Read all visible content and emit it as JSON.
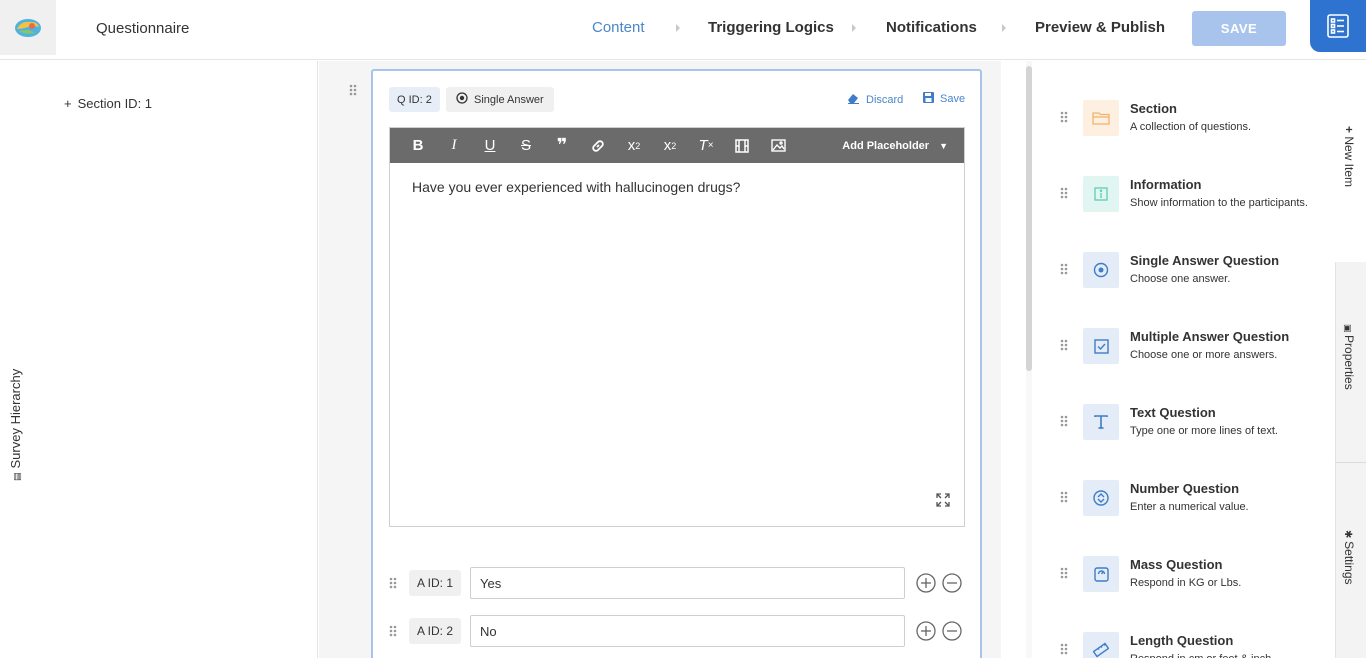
{
  "header": {
    "app_title": "Questionnaire",
    "nav": [
      {
        "label": "Content",
        "active": true
      },
      {
        "label": "Triggering Logics",
        "active": false
      },
      {
        "label": "Notifications",
        "active": false
      },
      {
        "label": "Preview & Publish",
        "active": false
      }
    ],
    "save_label": "SAVE",
    "logo_icon": "brain-logo-icon",
    "topright_icon": "checklist-icon"
  },
  "left_panel": {
    "vertical_label": "Survey Hierarchy",
    "tree": [
      {
        "expand": "+",
        "label": "Section ID: 1"
      }
    ]
  },
  "question": {
    "qid_label": "Q ID: 2",
    "type_label": "Single Answer",
    "discard_label": "Discard",
    "save_label": "Save",
    "add_placeholder_label": "Add Placeholder",
    "text": "Have you ever experienced with hallucinogen drugs?",
    "answers": [
      {
        "id_label": "A ID: 1",
        "value": "Yes"
      },
      {
        "id_label": "A ID: 2",
        "value": "No"
      }
    ]
  },
  "right_panel": {
    "items": [
      {
        "title": "Section",
        "desc": "A collection of questions.",
        "icon": "folder-icon",
        "icon_bg": "#fdf0e1",
        "icon_color": "#f2b36b"
      },
      {
        "title": "Information",
        "desc": "Show information to the participants.",
        "icon": "info-icon",
        "icon_bg": "#e2f6f1",
        "icon_color": "#5ccfb3"
      },
      {
        "title": "Single Answer Question",
        "desc": "Choose one answer.",
        "icon": "radio-icon",
        "icon_bg": "#e4ecf7",
        "icon_color": "#3f7cc9"
      },
      {
        "title": "Multiple Answer Question",
        "desc": "Choose one or more answers.",
        "icon": "checkbox-icon",
        "icon_bg": "#e4ecf7",
        "icon_color": "#3f7cc9"
      },
      {
        "title": "Text Question",
        "desc": "Type one or more lines of text.",
        "icon": "text-icon",
        "icon_bg": "#e4ecf7",
        "icon_color": "#3f7cc9"
      },
      {
        "title": "Number Question",
        "desc": "Enter a numerical value.",
        "icon": "number-icon",
        "icon_bg": "#e4ecf7",
        "icon_color": "#3f7cc9"
      },
      {
        "title": "Mass Question",
        "desc": "Respond in KG or Lbs.",
        "icon": "scale-icon",
        "icon_bg": "#e4ecf7",
        "icon_color": "#3f7cc9"
      },
      {
        "title": "Length Question",
        "desc": "Respond in cm or feet & inch.",
        "icon": "ruler-icon",
        "icon_bg": "#e4ecf7",
        "icon_color": "#3f7cc9"
      }
    ]
  },
  "side_tabs": {
    "new_item": "New Item",
    "properties": "Properties",
    "settings": "Settings"
  }
}
